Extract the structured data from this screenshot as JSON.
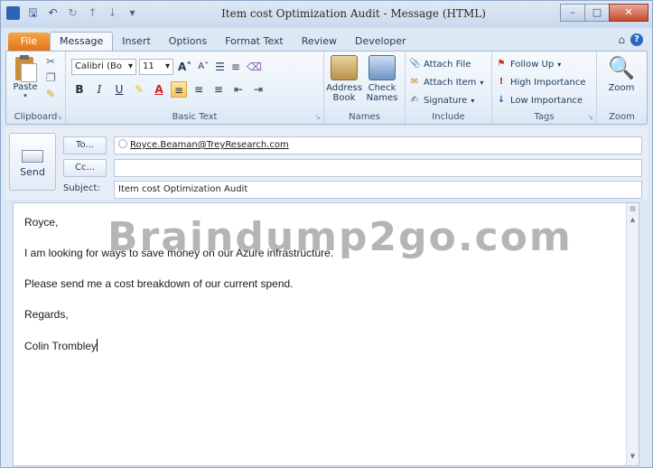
{
  "window": {
    "title": "Item cost Optimization Audit - Message (HTML)",
    "controls": {
      "minimize": "–",
      "maximize": "□",
      "close": "✕"
    }
  },
  "tabs": [
    {
      "label": "File"
    },
    {
      "label": "Message"
    },
    {
      "label": "Insert"
    },
    {
      "label": "Options"
    },
    {
      "label": "Format Text"
    },
    {
      "label": "Review"
    },
    {
      "label": "Developer"
    }
  ],
  "ribbon": {
    "clipboard": {
      "label": "Clipboard",
      "paste": "Paste"
    },
    "basic_text": {
      "label": "Basic Text",
      "font": "Calibri (Body)",
      "size": "11"
    },
    "names": {
      "label": "Names",
      "address_book": "Address Book",
      "check_names": "Check Names"
    },
    "include": {
      "label": "Include",
      "attach_file": "Attach File",
      "attach_item": "Attach Item",
      "signature": "Signature"
    },
    "tags": {
      "label": "Tags",
      "follow_up": "Follow Up",
      "high_importance": "High Importance",
      "low_importance": "Low Importance"
    },
    "zoom": {
      "label": "Zoom",
      "button": "Zoom"
    }
  },
  "header": {
    "send": "Send",
    "to_button": "To...",
    "cc_button": "Cc...",
    "subject_label": "Subject:",
    "to_value": "Royce.Beaman@TreyResearch.com",
    "cc_value": "",
    "subject_value": "Item cost Optimization Audit"
  },
  "body": {
    "lines": [
      "Royce,",
      "I am looking for ways to save money on our Azure infrastructure.",
      "Please send me a cost breakdown of our current spend.",
      "Regards,",
      "Colin Trombley"
    ]
  },
  "watermark": "Braindump2go.com"
}
